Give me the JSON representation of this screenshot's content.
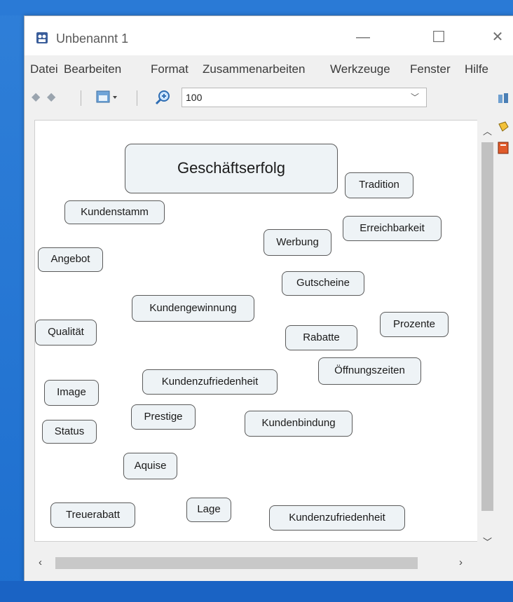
{
  "window": {
    "title": "Unbenannt 1",
    "controls": {
      "minimize": "—",
      "maximize": "☐",
      "close": "✕"
    }
  },
  "menu": [
    "Datei",
    "Bearbeiten",
    "Format",
    "Zusammenarbeiten",
    "Werkzeuge",
    "Fenster",
    "Hilfe"
  ],
  "toolbar": {
    "zoom_value": "100",
    "icons": [
      "back-arrow-icon",
      "forward-arrow-icon",
      "view-options-icon",
      "zoom-icon"
    ]
  },
  "concept_map": {
    "nodes": [
      {
        "id": "geschaeftserfolg",
        "label": "Geschäftserfolg",
        "main": true
      },
      {
        "id": "tradition",
        "label": "Tradition"
      },
      {
        "id": "kundenstamm",
        "label": "Kundenstamm"
      },
      {
        "id": "werbung",
        "label": "Werbung"
      },
      {
        "id": "erreichbarkeit",
        "label": "Erreichbarkeit"
      },
      {
        "id": "angebot",
        "label": "Angebot"
      },
      {
        "id": "gutscheine",
        "label": "Gutscheine"
      },
      {
        "id": "kundengewinnung",
        "label": "Kundengewinnung"
      },
      {
        "id": "qualitaet",
        "label": "Qualität"
      },
      {
        "id": "rabatte",
        "label": "Rabatte"
      },
      {
        "id": "prozente",
        "label": "Prozente"
      },
      {
        "id": "oeffnungszeiten",
        "label": "Öffnungszeiten"
      },
      {
        "id": "kundenzufriedenheit1",
        "label": "Kundenzufriedenheit"
      },
      {
        "id": "image",
        "label": "Image"
      },
      {
        "id": "prestige",
        "label": "Prestige"
      },
      {
        "id": "kundenbindung",
        "label": "Kundenbindung"
      },
      {
        "id": "status",
        "label": "Status"
      },
      {
        "id": "aquise",
        "label": "Aquise"
      },
      {
        "id": "treuerabatt",
        "label": "Treuerabatt"
      },
      {
        "id": "lage",
        "label": "Lage"
      },
      {
        "id": "kundenzufriedenheit2",
        "label": "Kundenzufriedenheit"
      }
    ]
  },
  "colors": {
    "node_fill": "#eef3f6",
    "node_border": "#5a5a5a",
    "desktop": "#2a7ad6"
  }
}
